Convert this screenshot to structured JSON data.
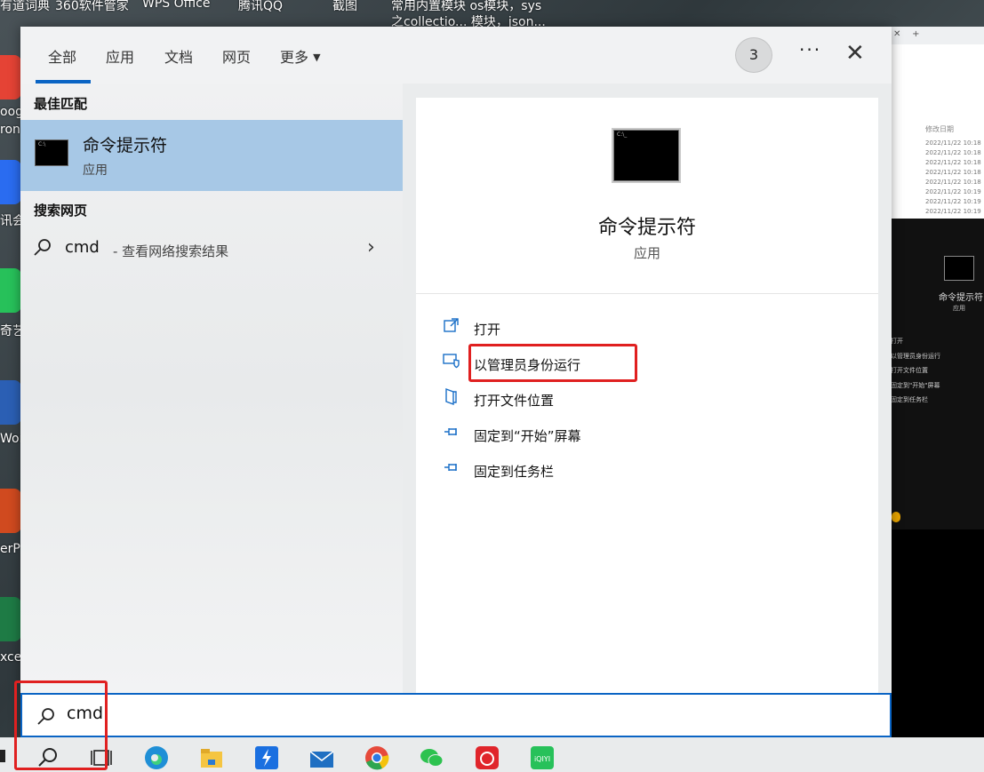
{
  "desktop": {
    "top_labels": [
      "有道词典",
      "360软件管家",
      "WPS Office",
      "腾讯QQ",
      "截图",
      "常用内置模块 os模块，sys",
      "之collectio... 模块，json..."
    ],
    "side_labels": [
      "oog",
      "ron",
      "讯会",
      "奇艺",
      "Wor",
      "erP",
      "xce"
    ],
    "bg_window": {
      "header": "修改日期",
      "dates": [
        "2022/11/22 10:18",
        "2022/11/22 10:18",
        "2022/11/22 10:18",
        "2022/11/22 10:18",
        "2022/11/22 10:18",
        "2022/11/22 10:19",
        "2022/11/22 10:19",
        "2022/11/22 10:19"
      ],
      "preview_title": "命令提示符",
      "preview_sub": "应用",
      "menu": [
        "打开",
        "以管理员身份运行",
        "打开文件位置",
        "固定到\"开始\"屏幕",
        "固定到任务栏"
      ]
    }
  },
  "tabs": [
    "全部",
    "应用",
    "文档",
    "网页",
    "更多"
  ],
  "badge": "3",
  "more_label": "···",
  "close_label": "✕",
  "best_match": {
    "heading": "最佳匹配",
    "name": "命令提示符",
    "type": "应用"
  },
  "web_search": {
    "heading": "搜索网页",
    "query": "cmd",
    "desc": "- 查看网络搜索结果"
  },
  "detail": {
    "title": "命令提示符",
    "sub": "应用",
    "actions": [
      "打开",
      "以管理员身份运行",
      "打开文件位置",
      "固定到“开始”屏幕",
      "固定到任务栏"
    ]
  },
  "search": {
    "value": "cmd"
  },
  "colors": {
    "accent": "#0a64c4",
    "selection": "#a7c8e6",
    "highlight_box": "#e02020"
  },
  "icons": [
    "search-icon",
    "task-view-icon",
    "edge-icon",
    "file-explorer-icon",
    "app-icon",
    "mail-icon",
    "chrome-icon",
    "wechat-icon",
    "netease-music-icon",
    "iqiyi-icon"
  ]
}
